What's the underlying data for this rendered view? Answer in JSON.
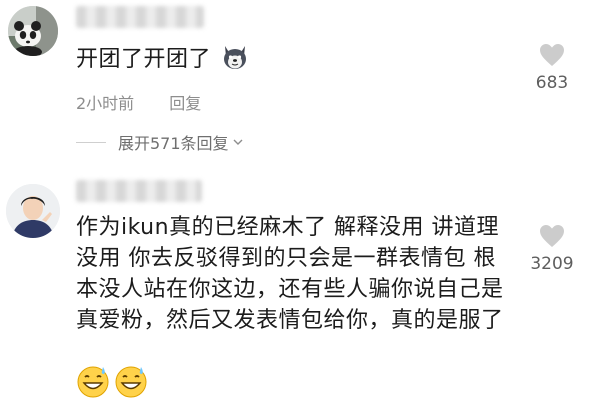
{
  "comments": [
    {
      "text_lines": [
        "开团了开团了"
      ],
      "time": "2小时前",
      "reply_label": "回复",
      "likes": "683",
      "expand_label": "展开571条回复",
      "trailing_emoji": "dog-emoji"
    },
    {
      "text_lines": [
        "作为ikun真的已经麻木了 解释没用 讲道理",
        "没用 你去反驳得到的只会是一群表情包 根",
        "本没人站在你这边，还有些人骗你说自己是",
        "真爱粉，然后又发表情包给你，真的是服了"
      ],
      "likes": "3209",
      "emojis": [
        "sweat-grin-emoji",
        "sweat-grin-emoji"
      ]
    }
  ],
  "colors": {
    "text": "#1c1c1c",
    "meta": "#8d8d8d",
    "heart": "#cccccc"
  }
}
